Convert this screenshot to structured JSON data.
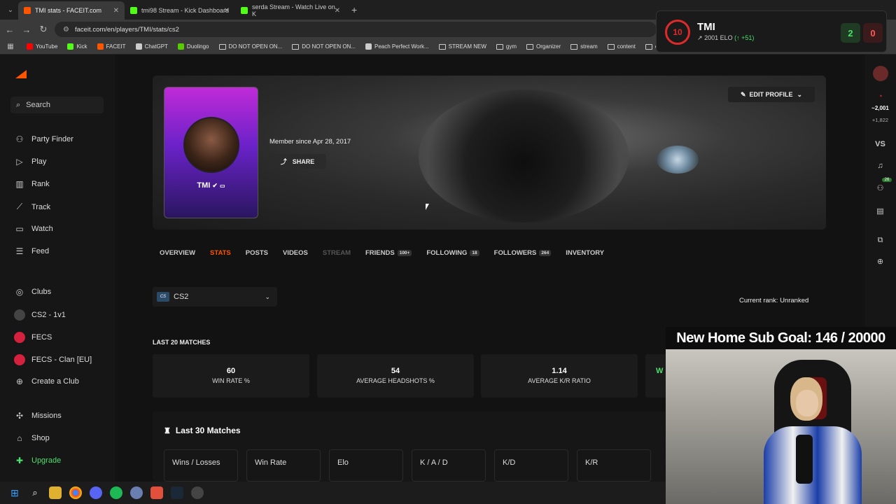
{
  "browser": {
    "tabs": [
      {
        "title": "TMI stats - FACEIT.com",
        "color": "#ff5500"
      },
      {
        "title": "tmi98 Stream - Kick Dashboard",
        "color": "#53fc18"
      },
      {
        "title": "serda Stream - Watch Live on K",
        "color": "#53fc18"
      }
    ],
    "url": "faceit.com/en/players/TMI/stats/cs2",
    "bookmarks": [
      {
        "label": "YouTube",
        "kind": "icon",
        "color": "#ff0000"
      },
      {
        "label": "Kick",
        "kind": "icon",
        "color": "#53fc18"
      },
      {
        "label": "FACEIT",
        "kind": "icon",
        "color": "#ff5500"
      },
      {
        "label": "ChatGPT",
        "kind": "icon",
        "color": "#cccccc"
      },
      {
        "label": "Duolingo",
        "kind": "icon",
        "color": "#58cc02"
      },
      {
        "label": "DO NOT OPEN ON...",
        "kind": "folder"
      },
      {
        "label": "DO NOT OPEN ON...",
        "kind": "folder"
      },
      {
        "label": "Peach Perfect Work...",
        "kind": "icon",
        "color": "#cccccc"
      },
      {
        "label": "STREAM NEW",
        "kind": "folder"
      },
      {
        "label": "gym",
        "kind": "folder"
      },
      {
        "label": "Organizer",
        "kind": "folder"
      },
      {
        "label": "stream",
        "kind": "folder"
      },
      {
        "label": "content",
        "kind": "folder"
      },
      {
        "label": "cs",
        "kind": "folder"
      }
    ]
  },
  "sidebar": {
    "search": "Search",
    "nav": [
      {
        "label": "Party Finder",
        "icon": "users-icon"
      },
      {
        "label": "Play",
        "icon": "play-icon"
      },
      {
        "label": "Rank",
        "icon": "rank-icon"
      },
      {
        "label": "Track",
        "icon": "track-icon"
      },
      {
        "label": "Watch",
        "icon": "watch-icon"
      },
      {
        "label": "Feed",
        "icon": "feed-icon"
      }
    ],
    "clubs_label": "Clubs",
    "clubs": [
      {
        "label": "CS2 - 1v1",
        "color": "#444444"
      },
      {
        "label": "FECS",
        "color": "#d4213d"
      },
      {
        "label": "FECS - Clan [EU]",
        "color": "#d4213d"
      }
    ],
    "create_club": "Create a Club",
    "missions": "Missions",
    "shop": "Shop",
    "upgrade": "Upgrade"
  },
  "profile": {
    "name": "TMI",
    "member_since": "Member since Apr 28, 2017",
    "share": "SHARE",
    "edit": "EDIT PROFILE",
    "tabs": [
      {
        "label": "OVERVIEW",
        "state": "normal"
      },
      {
        "label": "STATS",
        "state": "active"
      },
      {
        "label": "POSTS",
        "state": "normal"
      },
      {
        "label": "VIDEOS",
        "state": "normal"
      },
      {
        "label": "STREAM",
        "state": "dim"
      },
      {
        "label": "FRIENDS",
        "state": "normal",
        "count": "100+"
      },
      {
        "label": "FOLLOWING",
        "state": "normal",
        "count": "18"
      },
      {
        "label": "FOLLOWERS",
        "state": "normal",
        "count": "264"
      },
      {
        "label": "INVENTORY",
        "state": "normal"
      }
    ],
    "game": "CS2",
    "current_rank": "Current rank: Unranked",
    "last20_label": "LAST 20 MATCHES",
    "last20": [
      {
        "value": "60",
        "label": "WIN RATE %"
      },
      {
        "value": "54",
        "label": "AVERAGE HEADSHOTS %"
      },
      {
        "value": "1.14",
        "label": "AVERAGE K/R RATIO"
      }
    ],
    "last30_title": "Last 30 Matches",
    "last30_cols": [
      "Wins / Losses",
      "Win Rate",
      "Elo",
      "K / A / D",
      "K/D",
      "K/R"
    ]
  },
  "elo_widget": {
    "level": "10",
    "name": "TMI",
    "elo": "2001 ELO",
    "change": "(↑ +51)",
    "wins": "2",
    "losses": "0"
  },
  "right_rail": {
    "elo": "~2,001",
    "delta": "+1,822",
    "vs": "VS",
    "badge": "26"
  },
  "stream": {
    "goal": "New Home Sub Goal:  146 / 20000"
  }
}
